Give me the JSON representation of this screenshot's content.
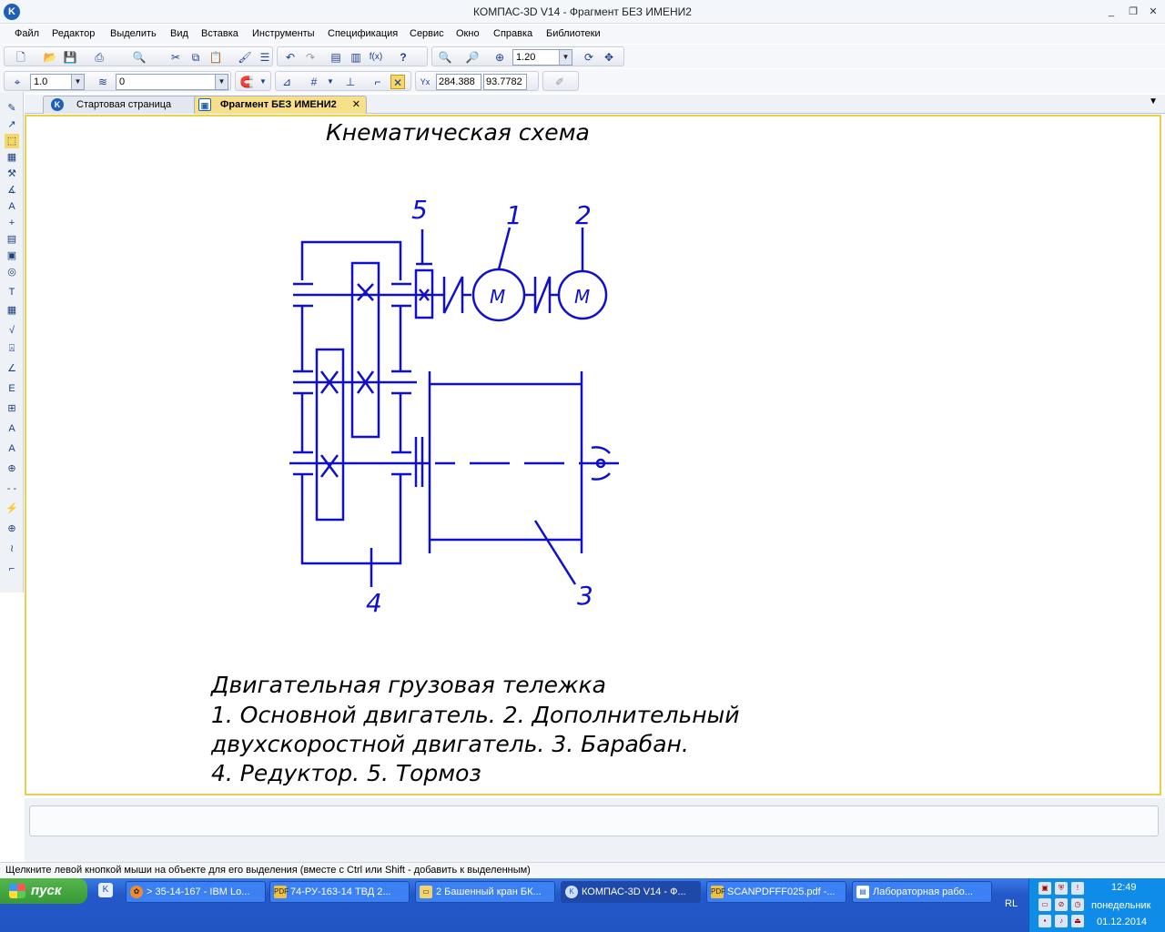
{
  "window": {
    "title": "КОМПАС-3D V14 - Фрагмент БЕЗ ИМЕНИ2"
  },
  "menu": [
    "Файл",
    "Редактор",
    "Выделить",
    "Вид",
    "Вставка",
    "Инструменты",
    "Спецификация",
    "Сервис",
    "Окно",
    "Справка",
    "Библиотеки"
  ],
  "toolbar": {
    "zoom_value": "1.20",
    "step_value": "1.0",
    "layer_value": "0",
    "coord_x": "284.388",
    "coord_y": "93.7782"
  },
  "tabs": [
    {
      "label": "Стартовая страница"
    },
    {
      "label": "Фрагмент БЕЗ ИМЕНИ2"
    }
  ],
  "drawing": {
    "title": "Кнематическая схема",
    "callouts": [
      "1",
      "2",
      "3",
      "4",
      "5"
    ],
    "motor_label": "M",
    "legend_lines": [
      "Двигательная грузовая тележка",
      "1. Основной двигатель. 2. Дополнительный",
      "двухскоростной двигатель. 3. Барабан.",
      "4. Редуктор. 5. Тормоз"
    ]
  },
  "status": {
    "hint": "Щелкните левой кнопкой мыши на объекте для его выделения (вместе с Ctrl или Shift - добавить к выделенным)"
  },
  "taskbar": {
    "start_label": "пуск",
    "tasks": [
      "> 35-14-167 - IBM Lo...",
      "74-РУ-163-14 ТВД 2...",
      "2 Башенный кран БК...",
      "КОМПАС-3D V14 - Ф...",
      "SCANPDFFF025.pdf -...",
      "Лабораторная рабо..."
    ],
    "lang": "RL",
    "time": "12:49",
    "weekday": "понедельник",
    "date": "01.12.2014"
  },
  "colors": {
    "drawing": "#1010cc",
    "canvas_border": "#e8d04a",
    "taskbar": "#2458c9"
  }
}
